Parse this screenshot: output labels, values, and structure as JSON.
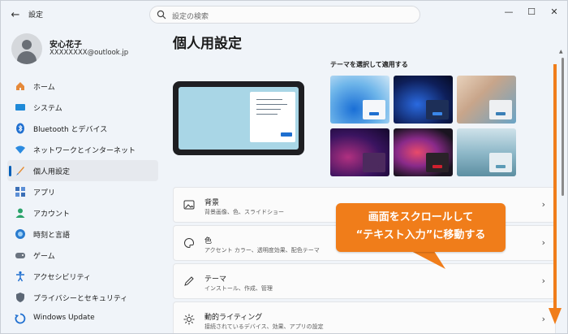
{
  "titlebar": {
    "title": "設定"
  },
  "search": {
    "placeholder": "設定の検索"
  },
  "profile": {
    "name": "安心花子",
    "email": "XXXXXXXX@outlook.jp"
  },
  "sidebar": {
    "items": [
      {
        "label": "ホーム",
        "icon": "home-icon"
      },
      {
        "label": "システム",
        "icon": "monitor-icon"
      },
      {
        "label": "Bluetooth とデバイス",
        "icon": "bluetooth-icon"
      },
      {
        "label": "ネットワークとインターネット",
        "icon": "wifi-icon"
      },
      {
        "label": "個人用設定",
        "icon": "brush-icon",
        "active": true
      },
      {
        "label": "アプリ",
        "icon": "apps-icon"
      },
      {
        "label": "アカウント",
        "icon": "person-icon"
      },
      {
        "label": "時刻と言語",
        "icon": "globe-icon"
      },
      {
        "label": "ゲーム",
        "icon": "gamepad-icon"
      },
      {
        "label": "アクセシビリティ",
        "icon": "accessibility-icon"
      },
      {
        "label": "プライバシーとセキュリティ",
        "icon": "shield-icon"
      },
      {
        "label": "Windows Update",
        "icon": "update-icon"
      }
    ]
  },
  "main": {
    "title": "個人用設定",
    "themes_label": "テーマを選択して適用する",
    "cards": [
      {
        "title": "背景",
        "subtitle": "背景画像、色、スライドショー",
        "icon": "image-icon"
      },
      {
        "title": "色",
        "subtitle": "アクセント カラー、透明度効果、配色テーマ",
        "icon": "palette-icon"
      },
      {
        "title": "テーマ",
        "subtitle": "インストール、作成、管理",
        "icon": "pen-icon"
      },
      {
        "title": "動的ライティング",
        "subtitle": "接続されているデバイス、効果、アプリの設定",
        "icon": "sun-icon"
      }
    ]
  },
  "annotation": {
    "line1": "画面をスクロールして",
    "line2": "“テキスト入力”に移動する"
  },
  "colors": {
    "accent": "#005fb8",
    "annotation": "#f07d1a"
  }
}
